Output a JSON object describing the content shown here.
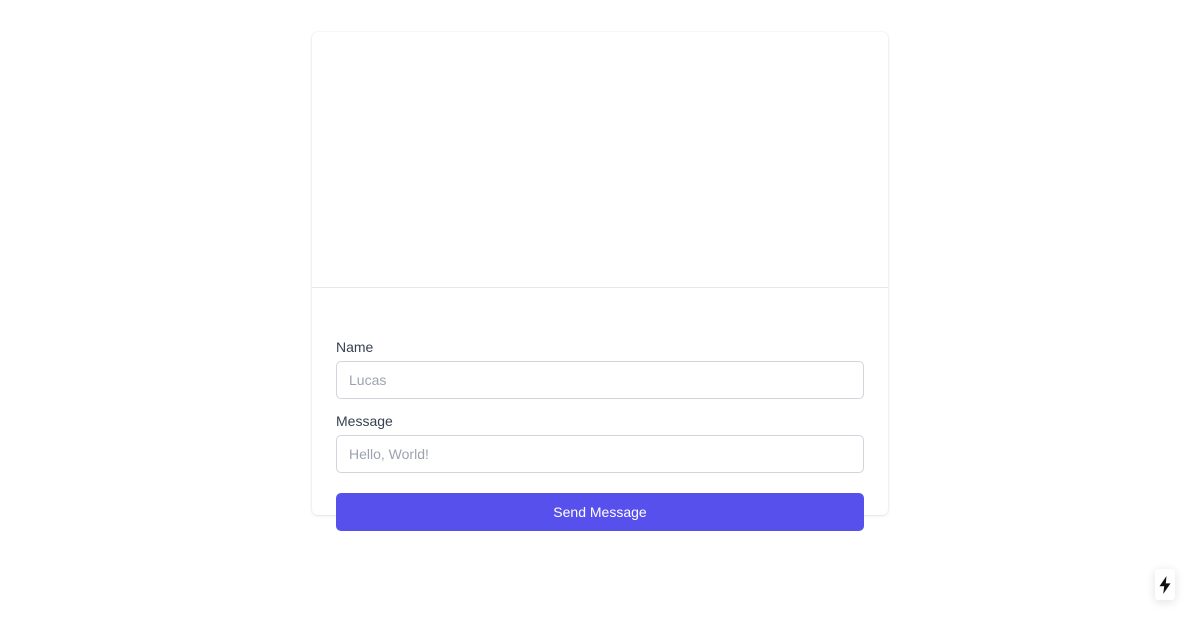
{
  "chat": {
    "messages": []
  },
  "form": {
    "name_label": "Name",
    "name_placeholder": "Lucas",
    "name_value": "",
    "message_label": "Message",
    "message_placeholder": "Hello, World!",
    "message_value": "",
    "send_label": "Send Message"
  },
  "badge": {
    "icon": "lightning-bolt-icon"
  },
  "colors": {
    "accent": "#5850ec",
    "label_text": "#374151",
    "placeholder_text": "#9ca3af",
    "border": "#d1d5db",
    "divider": "#e5e7eb"
  }
}
